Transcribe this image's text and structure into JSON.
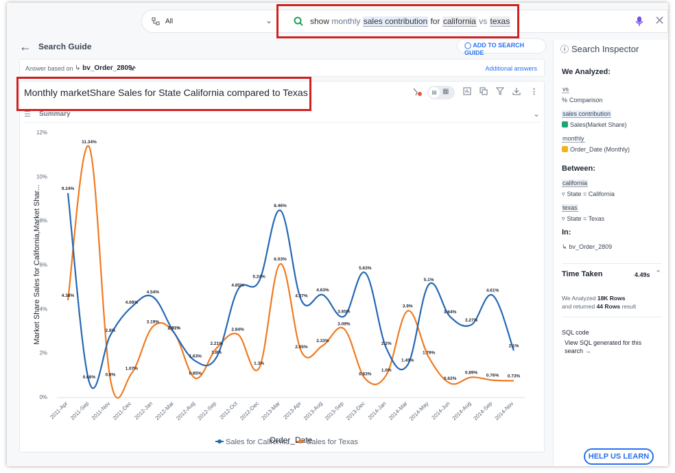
{
  "search": {
    "source_label": "All",
    "tokens": {
      "show": "show",
      "monthly": "monthly",
      "sales_contribution": "sales contribution",
      "for": "for",
      "california": "california",
      "vs": "vs",
      "texas": "texas"
    }
  },
  "guide": {
    "back_label": "Search Guide",
    "add_label": "ADD TO SEARCH GUIDE"
  },
  "answer": {
    "based_on": "Answer based on",
    "table": "bv_Order_2809",
    "additional": "Additional answers"
  },
  "card": {
    "title": "Monthly marketShare Sales for State California compared to Texas",
    "summary": "Summary"
  },
  "inspector": {
    "title": "Search Inspector",
    "analyzed_heading": "We Analyzed:",
    "vs_token": "vs",
    "vs_desc": "Comparison",
    "sales_token": "sales contribution",
    "sales_desc": "Sales(Market Share)",
    "monthly_token": "monthly",
    "monthly_desc": "Order_Date (Monthly)",
    "between_heading": "Between:",
    "california_token": "california",
    "california_desc": "State = California",
    "texas_token": "texas",
    "texas_desc": "State = Texas",
    "in_heading": "In:",
    "in_table": "bv_Order_2809",
    "time_heading": "Time Taken",
    "time_value": "4.49s",
    "analyzed_line_1a": "We Analyzed",
    "analyzed_rows": "18K Rows",
    "analyzed_line_2a": "and returned",
    "returned_rows": "44 Rows",
    "analyzed_line_2b": "result",
    "sql_heading": "SQL code",
    "sql_link": "View SQL generated for this search →",
    "help_button": "HELP US LEARN"
  },
  "colors": {
    "california": "#2467b5",
    "texas": "#f07a1f",
    "highlight_box": "#d0201f",
    "accent": "#2770ef"
  },
  "chart_data": {
    "type": "line",
    "xlabel": "Order_Date",
    "ylabel": "Market Share Sales for California,Market Shar...",
    "ylim": [
      0,
      12
    ],
    "y_ticks": [
      "0%",
      "2%",
      "4%",
      "6%",
      "8%",
      "10%",
      "12%"
    ],
    "x_tick_labels": [
      "2011-Apr",
      "2011-Sep",
      "2011-Nov",
      "2011-Dec",
      "2012-Jan",
      "2012-Mar",
      "2012-Aug",
      "2012-Sep",
      "2012-Oct",
      "2012-Dec",
      "2013-Mar",
      "2013-Apr",
      "2013-Aug",
      "2013-Sep",
      "2013-Dec",
      "2014-Jan",
      "2014-Mar",
      "2014-May",
      "2014-Jun",
      "2014-Aug",
      "2014-Sep",
      "2014-Nov"
    ],
    "series": [
      {
        "name": "Sales for California",
        "values": [
          9.24,
          0.68,
          2.8,
          4.08,
          4.54,
          2.91,
          1.63,
          1.8,
          4.85,
          5.24,
          8.46,
          4.37,
          4.63,
          3.65,
          5.63,
          2.2,
          1.45,
          5.1,
          3.64,
          3.27,
          4.61,
          2.1
        ],
        "labels": [
          "9.24%",
          "0.68%",
          "2.8%",
          "4.08%",
          "4.54%",
          "2.91%",
          "1.63%",
          "1.8%",
          "4.85%",
          "5.24%",
          "8.46%",
          "4.37%",
          "4.63%",
          "3.65%",
          "5.63%",
          "2.2%",
          "1.45%",
          "5.1%",
          "3.64%",
          "3.27%",
          "4.61%",
          "2.1%"
        ]
      },
      {
        "name": "Sales for Texas",
        "values": [
          4.38,
          11.34,
          0.8,
          1.07,
          3.19,
          2.91,
          0.85,
          2.21,
          2.84,
          1.3,
          6.03,
          2.05,
          2.33,
          3.09,
          0.83,
          1.0,
          3.9,
          1.79,
          0.62,
          0.89,
          0.76,
          0.73
        ],
        "labels": [
          "4.38%",
          "11.34%",
          "0.8%",
          "1.07%",
          "3.19%",
          "2.91%",
          "0.85%",
          "2.21%",
          "2.84%",
          "1.3%",
          "6.03%",
          "2.05%",
          "2.33%",
          "3.09%",
          "0.83%",
          "1.0%",
          "3.9%",
          "1.79%",
          "0.62%",
          "0.89%",
          "0.76%",
          "0.73%"
        ]
      }
    ],
    "legend": "bottom",
    "grid": false
  }
}
